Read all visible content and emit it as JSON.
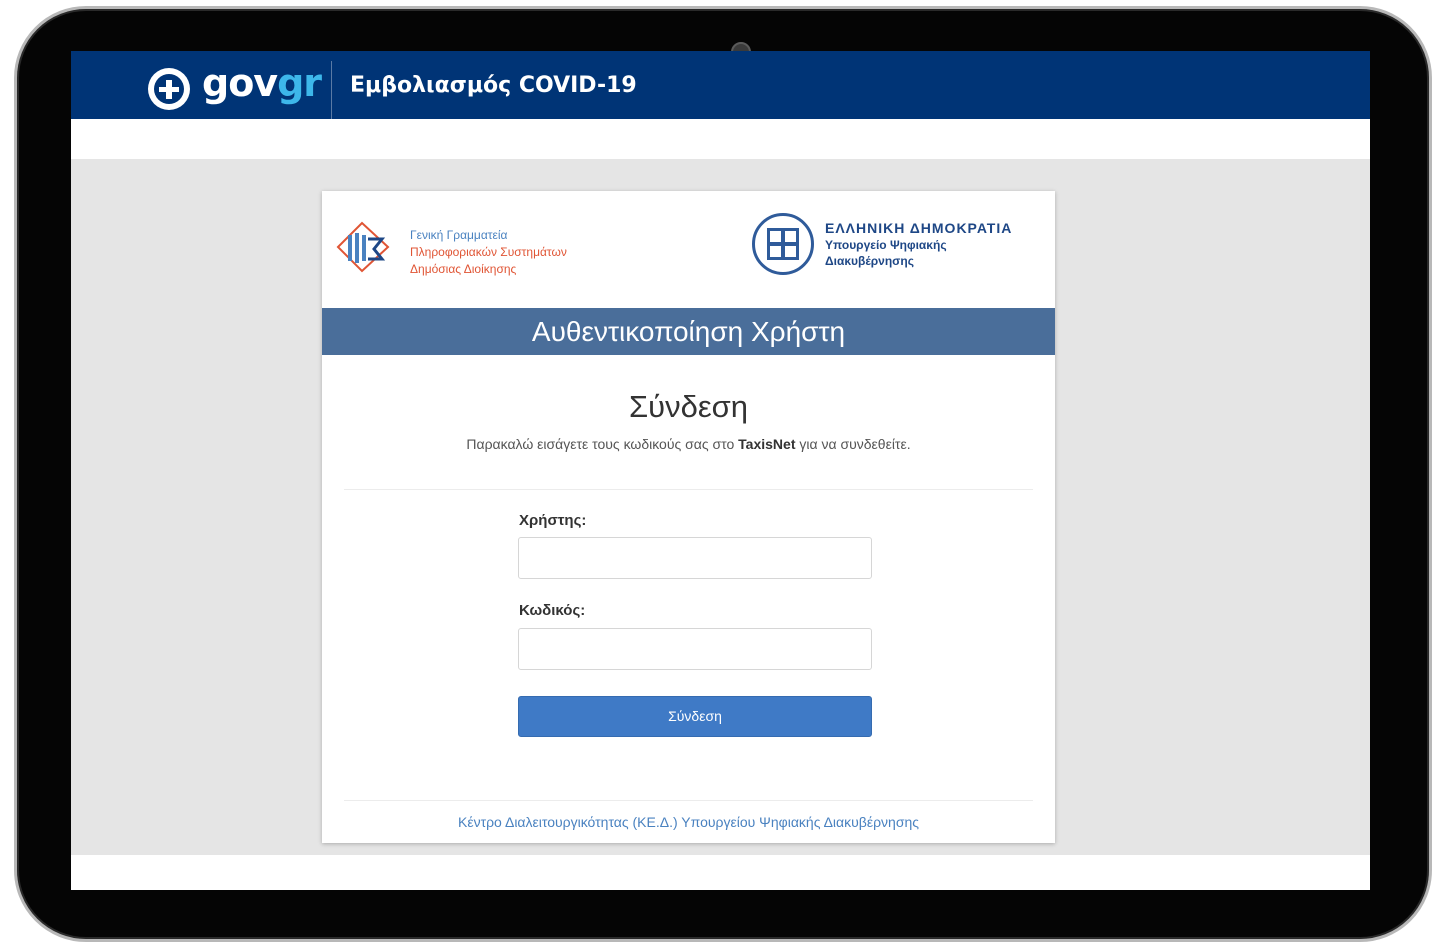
{
  "header": {
    "brand_gov": "gov",
    "brand_gr": "gr",
    "title": "Εμβολιασμός COVID-19"
  },
  "gsis": {
    "line1": "Γενική Γραμματεία",
    "line2": "Πληροφοριακών Συστημάτων",
    "line3": "Δημόσιας Διοίκησης"
  },
  "republic": {
    "line1": "ΕΛΛΗΝΙΚΗ ΔΗΜΟΚΡΑΤΙΑ",
    "line2": "Υπουργείο Ψηφιακής",
    "line3": "Διακυβέρνησης"
  },
  "auth_bar": "Αυθεντικοποίηση Χρήστη",
  "login": {
    "title": "Σύνδεση",
    "subtitle_pre": "Παρακαλώ εισάγετε τους κωδικούς σας στο ",
    "subtitle_bold": "TaxisNet",
    "subtitle_post": " για να συνδεθείτε.",
    "username_label": "Χρήστης:",
    "username_value": "",
    "password_label": "Κωδικός:",
    "password_value": "",
    "submit_label": "Σύνδεση"
  },
  "footer": "Κέντρο Διαλειτουργικότητας (ΚΕ.Δ.) Υπουργείου Ψηφιακής Διακυβέρνησης",
  "colors": {
    "header_bg": "#003476",
    "gr_accent": "#3db7ea",
    "auth_bar_bg": "#4a6e9a",
    "button_bg": "#3f7ac6"
  }
}
